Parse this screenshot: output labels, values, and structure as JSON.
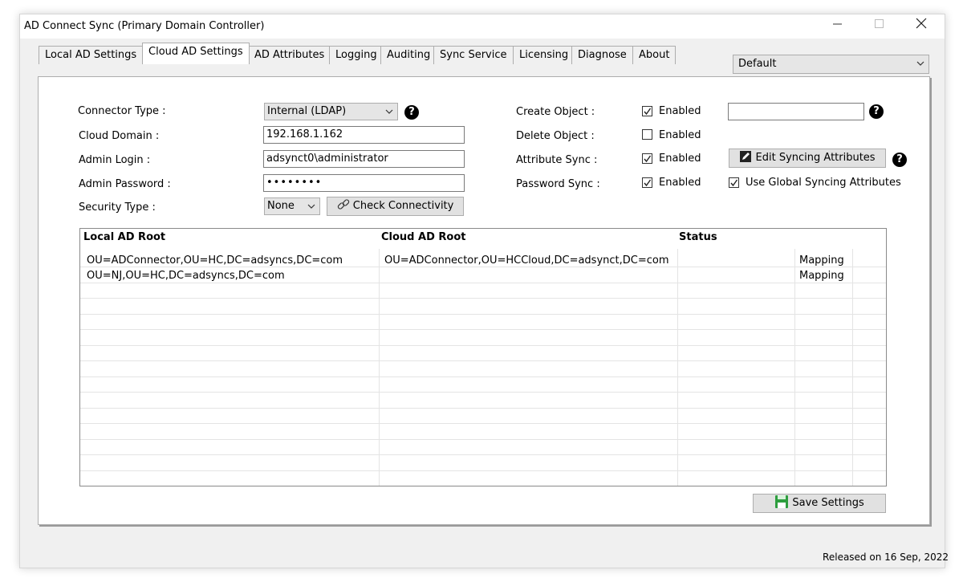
{
  "window": {
    "title": "AD Connect Sync (Primary Domain Controller)"
  },
  "tabs": [
    {
      "label": "Local AD Settings"
    },
    {
      "label": "Cloud AD Settings"
    },
    {
      "label": "AD Attributes"
    },
    {
      "label": "Logging"
    },
    {
      "label": "Auditing"
    },
    {
      "label": "Sync Service"
    },
    {
      "label": "Licensing"
    },
    {
      "label": "Diagnose"
    },
    {
      "label": "About"
    }
  ],
  "profile": {
    "value": "Default"
  },
  "form": {
    "connector_type_label": "Connector Type :",
    "connector_type_value": "Internal (LDAP)",
    "cloud_domain_label": "Cloud Domain :",
    "cloud_domain_value": "192.168.1.162",
    "admin_login_label": "Admin Login :",
    "admin_login_value": "adsynct0\\administrator",
    "admin_password_label": "Admin Password :",
    "admin_password_value": "••••••••",
    "security_type_label": "Security Type :",
    "security_type_value": "None",
    "check_connectivity_label": "Check Connectivity",
    "create_object_label": "Create Object :",
    "delete_object_label": "Delete Object :",
    "attribute_sync_label": "Attribute Sync :",
    "password_sync_label": "Password Sync :",
    "enabled_label": "Enabled",
    "create_object_checked": true,
    "delete_object_checked": false,
    "attribute_sync_checked": true,
    "password_sync_checked": true,
    "create_object_extra_value": "",
    "edit_syncing_label": "Edit Syncing Attributes",
    "use_global_label": "Use Global Syncing Attributes",
    "use_global_checked": true,
    "help_glyph": "?"
  },
  "grid": {
    "columns": [
      "Local AD Root",
      "Cloud AD Root",
      "Status",
      ""
    ],
    "rows": [
      [
        "OU=ADConnector,OU=HC,DC=adsyncs,DC=com",
        "OU=ADConnector,OU=HCCloud,DC=adsynct,DC=com",
        "",
        "Mapping"
      ],
      [
        "OU=NJ,OU=HC,DC=adsyncs,DC=com",
        "",
        "",
        "Mapping"
      ]
    ]
  },
  "save_label": "Save Settings",
  "footer": {
    "released": "Released on 16 Sep, 2022"
  },
  "colors": {
    "save_icon": "#2e9e3f"
  }
}
